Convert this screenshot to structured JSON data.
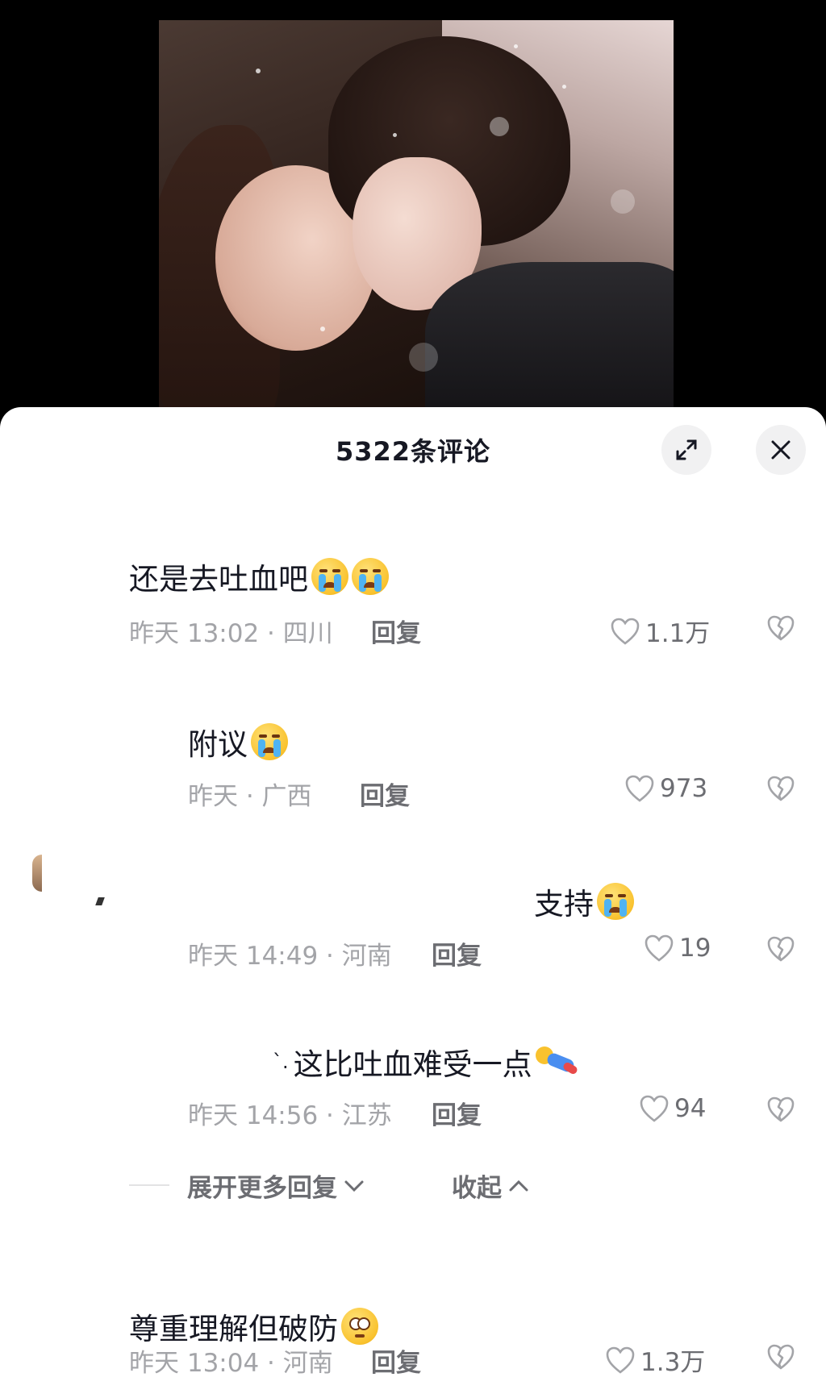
{
  "video": {
    "description_icon": "video-frame"
  },
  "sheet": {
    "title": "5322条评论",
    "expand_icon": "expand-icon",
    "close_icon": "close-icon"
  },
  "comments": [
    {
      "text": "还是去吐血吧",
      "emoji": [
        "crying-emoji",
        "crying-emoji"
      ],
      "meta": "昨天 13:02 · 四川",
      "reply": "回复",
      "likes": "1.1万"
    },
    {
      "text": "附议",
      "emoji": [
        "crying-emoji"
      ],
      "meta": "昨天 · 广西",
      "reply": "回复",
      "likes": "973"
    },
    {
      "text": "支持",
      "emoji": [
        "crying-emoji"
      ],
      "meta": "昨天 14:49 · 河南",
      "reply": "回复",
      "likes": "19"
    },
    {
      "text": "这比吐血难受一点",
      "emoji": [
        "lying-down-emoji"
      ],
      "meta": "昨天 14:56 · 江苏",
      "reply": "回复",
      "likes": "94"
    },
    {
      "text": "尊重理解但破防",
      "emoji": [
        "flushed-emoji"
      ],
      "meta": "昨天 13:04 · 河南",
      "reply": "回复",
      "likes": "1.3万"
    }
  ],
  "thread_controls": {
    "expand_more": "展开更多回复",
    "collapse": "收起"
  }
}
